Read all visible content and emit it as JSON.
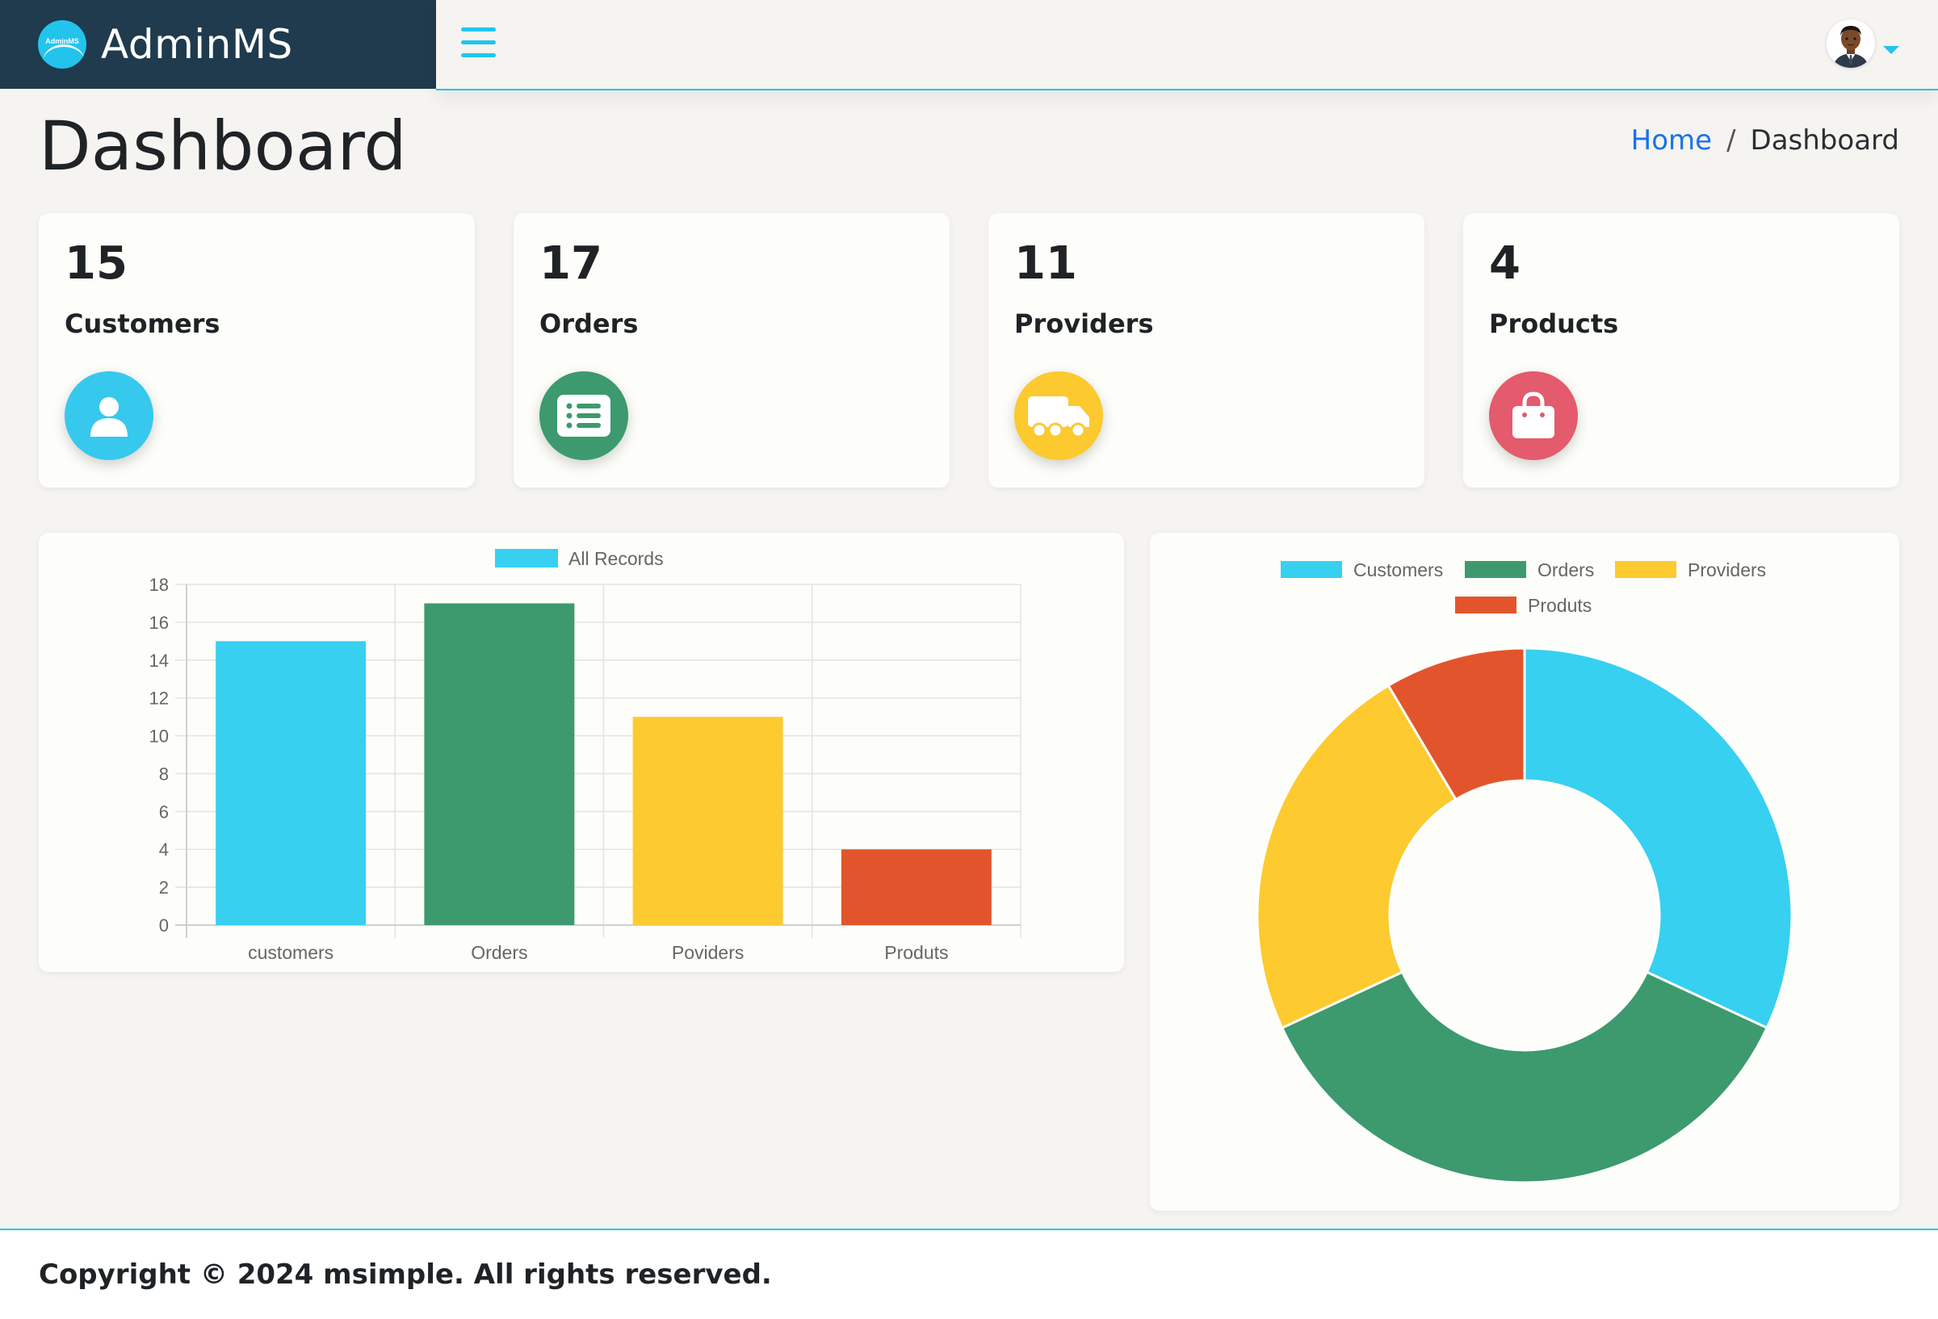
{
  "app": {
    "logo_text": "AdminMS",
    "brand_name": "AdminMS",
    "accent_color": "#22c4ee",
    "sidebar_color": "#1f3b4d"
  },
  "topbar": {
    "menu_icon": "hamburger-menu-icon",
    "avatar_icon": "user-avatar",
    "dropdown_icon": "caret-down-icon"
  },
  "page": {
    "title": "Dashboard",
    "breadcrumb": {
      "home": "Home",
      "separator": "/",
      "current": "Dashboard"
    }
  },
  "stats": [
    {
      "count": "15",
      "label": "Customers",
      "icon": "user-icon",
      "color": "#37c8ee"
    },
    {
      "count": "17",
      "label": "Orders",
      "icon": "list-icon",
      "color": "#3c9a6e"
    },
    {
      "count": "11",
      "label": "Providers",
      "icon": "truck-icon",
      "color": "#fcc92e"
    },
    {
      "count": "4",
      "label": "Products",
      "icon": "shopping-bag-icon",
      "color": "#e35b6d"
    }
  ],
  "chart_data": [
    {
      "type": "bar",
      "categories": [
        "customers",
        "Orders",
        "Poviders",
        "Produts"
      ],
      "series": [
        {
          "name": "All Records",
          "values": [
            15,
            17,
            11,
            4
          ]
        }
      ],
      "colors": [
        "#37d0f1",
        "#3c9a6e",
        "#fdca2f",
        "#e2552c"
      ],
      "legend_swatch_color": "#37d0f1",
      "ylim": [
        0,
        18
      ],
      "yticks": [
        "0",
        "2",
        "4",
        "6",
        "8",
        "10",
        "12",
        "14",
        "16",
        "18"
      ],
      "grid": true,
      "legend": "top"
    },
    {
      "type": "pie",
      "variant": "doughnut",
      "labels": [
        "Customers",
        "Orders",
        "Providers",
        "Produts"
      ],
      "values": [
        15,
        17,
        11,
        4
      ],
      "colors": [
        "#37d0f1",
        "#3c9a6e",
        "#fdca2f",
        "#e2552c"
      ],
      "legend": "top"
    }
  ],
  "footer": {
    "text": "Copyright © 2024 msimple. All rights reserved."
  }
}
